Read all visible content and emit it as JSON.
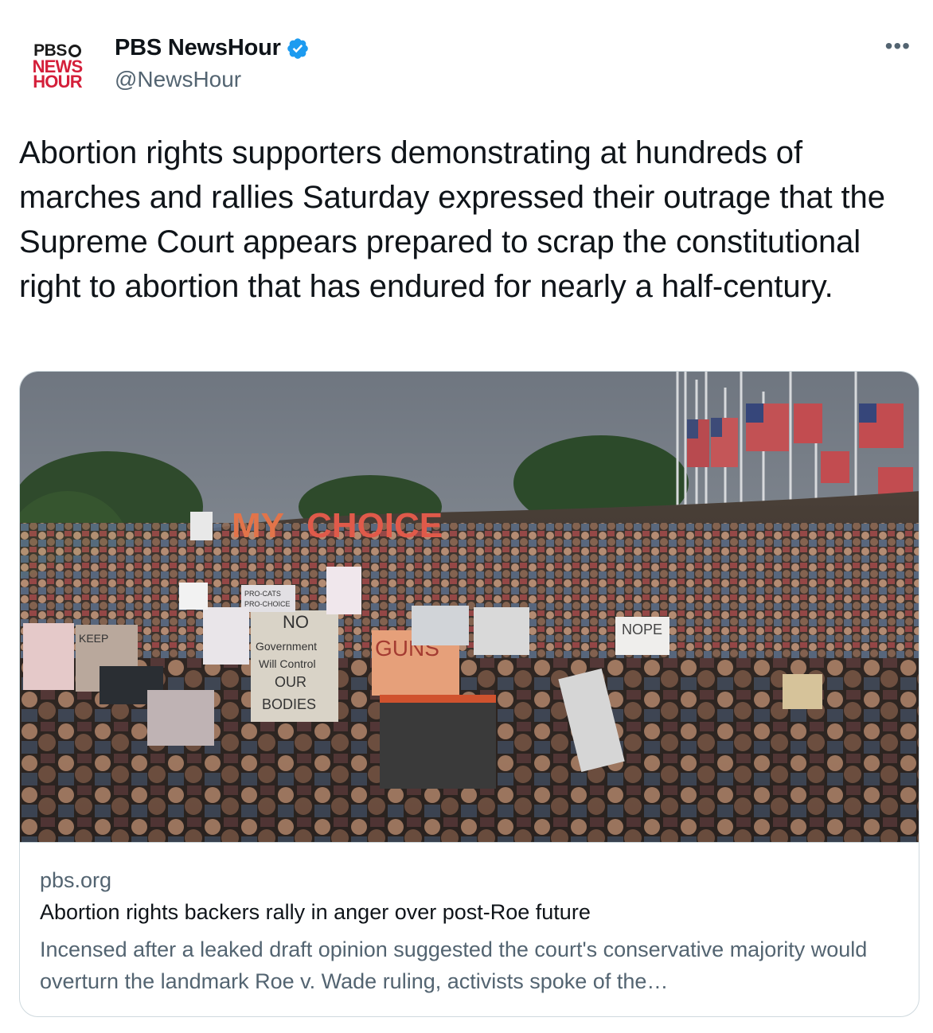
{
  "author": {
    "avatar_lines": [
      "PBS",
      "NEWS",
      "HOUR"
    ],
    "display_name": "PBS NewsHour",
    "handle": "@NewsHour",
    "verified": true,
    "verified_color": "#1d9bf0"
  },
  "more_label": "•••",
  "tweet_text": "Abortion rights supporters demonstrating at hundreds of marches and rallies Saturday expressed their outrage that the Supreme Court appears prepared to scrap the constitutional right to abortion that has endured for nearly a half-century.",
  "card": {
    "image_signs": [
      "MY",
      "CHOICE",
      "NO",
      "Government",
      "Will Control",
      "OUR",
      "BODIES",
      "GUNS",
      "NOPE",
      "PRO-CATS",
      "PRO-CHOICE",
      "KEEP"
    ],
    "domain": "pbs.org",
    "title": "Abortion rights backers rally in anger over post-Roe future",
    "description": "Incensed after a leaked draft opinion suggested the court's conservative majority would overturn the landmark Roe v. Wade ruling, activists spoke of the…"
  },
  "colors": {
    "text_primary": "#0f1419",
    "text_secondary": "#536471",
    "border": "#cfd9de",
    "pbs_red": "#d41f3a"
  }
}
